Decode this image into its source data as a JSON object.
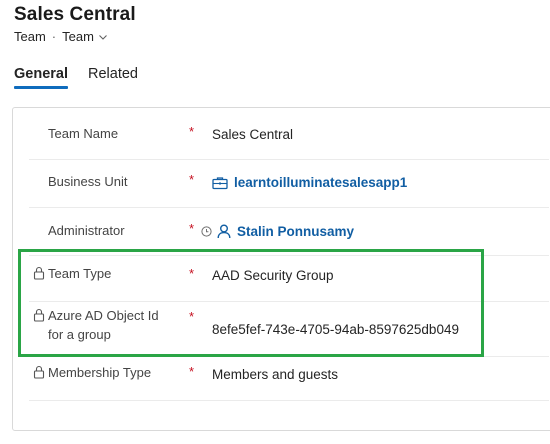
{
  "header": {
    "title": "Sales Central",
    "breadcrumb": [
      "Team",
      "Team"
    ]
  },
  "tabs": [
    {
      "label": "General",
      "active": true
    },
    {
      "label": "Related",
      "active": false
    }
  ],
  "fields": {
    "team_name": {
      "label": "Team Name",
      "required": "*",
      "value": "Sales Central"
    },
    "business_unit": {
      "label": "Business Unit",
      "required": "*",
      "value": "learntoilluminatesalesapp1"
    },
    "administrator": {
      "label": "Administrator",
      "required": "*",
      "value": "Stalin Ponnusamy"
    },
    "team_type": {
      "label": "Team Type",
      "required": "*",
      "value": "AAD Security Group"
    },
    "azure_ad_object_id": {
      "label_line1": "Azure AD Object Id",
      "label_line2": "for a group",
      "required": "*",
      "value": "8efe5fef-743e-4705-94ab-8597625db049"
    },
    "membership_type": {
      "label": "Membership Type",
      "required": "*",
      "value": "Members and guests"
    }
  },
  "colors": {
    "accent": "#0f6cbd",
    "link": "#115ea3",
    "required": "#c50f1f",
    "highlight": "#2aa546"
  },
  "icons": {
    "business_unit": "briefcase-icon",
    "admin_status": "clock-icon",
    "admin_person": "person-icon",
    "locked": "lock-icon",
    "breadcrumb_dropdown": "chevron-down-icon"
  }
}
